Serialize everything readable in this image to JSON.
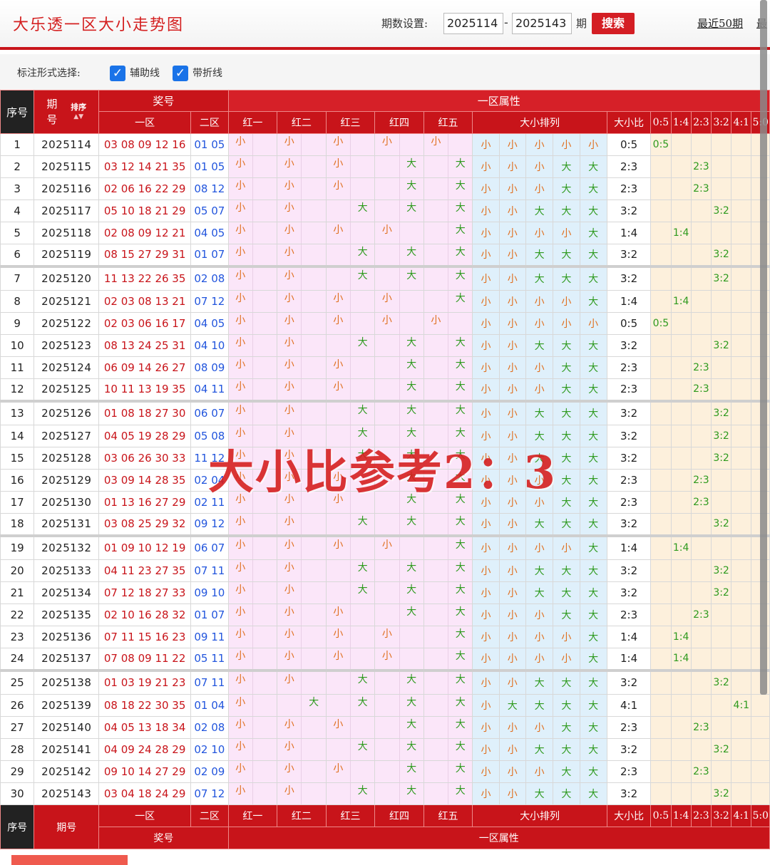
{
  "page": {
    "title": "大乐透一区大小走势图"
  },
  "period": {
    "label": "期数设置:",
    "from": "2025114",
    "dash": "-",
    "to": "2025143",
    "qi": "期",
    "search": "搜索",
    "recent": "最近50期",
    "recent_more": "最"
  },
  "options": {
    "label": "标注形式选择:",
    "aux_label": "辅助线",
    "line_label": "带折线"
  },
  "header": {
    "seq": "序号",
    "issue": "期号",
    "issue_top": "期",
    "issue_bottom": "号",
    "sort": "排序",
    "prize": "奖号",
    "zone_attr": "一区属性",
    "front": "一区",
    "back": "二区",
    "reds": [
      "红一",
      "红二",
      "红三",
      "红四",
      "红五"
    ],
    "arrangement": "大小排列",
    "ratio": "大小比",
    "dist": [
      "0:5",
      "1:4",
      "2:3",
      "3:2",
      "4:1",
      "5:0"
    ]
  },
  "rows": [
    {
      "seq": "1",
      "issue": "2025114",
      "front": "03 08 09 12 16",
      "back": "01 05",
      "reds": [
        "小",
        "小",
        "小",
        "小",
        "小"
      ],
      "arr": [
        "小",
        "小",
        "小",
        "小",
        "小"
      ],
      "ratio": "0:5"
    },
    {
      "seq": "2",
      "issue": "2025115",
      "front": "03 12 14 21 35",
      "back": "01 05",
      "reds": [
        "小",
        "小",
        "小",
        "大",
        "大"
      ],
      "arr": [
        "小",
        "小",
        "小",
        "大",
        "大"
      ],
      "ratio": "2:3"
    },
    {
      "seq": "3",
      "issue": "2025116",
      "front": "02 06 16 22 29",
      "back": "08 12",
      "reds": [
        "小",
        "小",
        "小",
        "大",
        "大"
      ],
      "arr": [
        "小",
        "小",
        "小",
        "大",
        "大"
      ],
      "ratio": "2:3"
    },
    {
      "seq": "4",
      "issue": "2025117",
      "front": "05 10 18 21 29",
      "back": "05 07",
      "reds": [
        "小",
        "小",
        "大",
        "大",
        "大"
      ],
      "arr": [
        "小",
        "小",
        "大",
        "大",
        "大"
      ],
      "ratio": "3:2"
    },
    {
      "seq": "5",
      "issue": "2025118",
      "front": "02 08 09 12 21",
      "back": "04 05",
      "reds": [
        "小",
        "小",
        "小",
        "小",
        "大"
      ],
      "arr": [
        "小",
        "小",
        "小",
        "小",
        "大"
      ],
      "ratio": "1:4"
    },
    {
      "seq": "6",
      "issue": "2025119",
      "front": "08 15 27 29 31",
      "back": "01 07",
      "reds": [
        "小",
        "小",
        "大",
        "大",
        "大"
      ],
      "arr": [
        "小",
        "小",
        "大",
        "大",
        "大"
      ],
      "ratio": "3:2"
    },
    {
      "seq": "7",
      "issue": "2025120",
      "front": "11 13 22 26 35",
      "back": "02 08",
      "reds": [
        "小",
        "小",
        "大",
        "大",
        "大"
      ],
      "arr": [
        "小",
        "小",
        "大",
        "大",
        "大"
      ],
      "ratio": "3:2"
    },
    {
      "seq": "8",
      "issue": "2025121",
      "front": "02 03 08 13 21",
      "back": "07 12",
      "reds": [
        "小",
        "小",
        "小",
        "小",
        "大"
      ],
      "arr": [
        "小",
        "小",
        "小",
        "小",
        "大"
      ],
      "ratio": "1:4"
    },
    {
      "seq": "9",
      "issue": "2025122",
      "front": "02 03 06 16 17",
      "back": "04 05",
      "reds": [
        "小",
        "小",
        "小",
        "小",
        "小"
      ],
      "arr": [
        "小",
        "小",
        "小",
        "小",
        "小"
      ],
      "ratio": "0:5"
    },
    {
      "seq": "10",
      "issue": "2025123",
      "front": "08 13 24 25 31",
      "back": "04 10",
      "reds": [
        "小",
        "小",
        "大",
        "大",
        "大"
      ],
      "arr": [
        "小",
        "小",
        "大",
        "大",
        "大"
      ],
      "ratio": "3:2"
    },
    {
      "seq": "11",
      "issue": "2025124",
      "front": "06 09 14 26 27",
      "back": "08 09",
      "reds": [
        "小",
        "小",
        "小",
        "大",
        "大"
      ],
      "arr": [
        "小",
        "小",
        "小",
        "大",
        "大"
      ],
      "ratio": "2:3"
    },
    {
      "seq": "12",
      "issue": "2025125",
      "front": "10 11 13 19 35",
      "back": "04 11",
      "reds": [
        "小",
        "小",
        "小",
        "大",
        "大"
      ],
      "arr": [
        "小",
        "小",
        "小",
        "大",
        "大"
      ],
      "ratio": "2:3"
    },
    {
      "seq": "13",
      "issue": "2025126",
      "front": "01 08 18 27 30",
      "back": "06 07",
      "reds": [
        "小",
        "小",
        "大",
        "大",
        "大"
      ],
      "arr": [
        "小",
        "小",
        "大",
        "大",
        "大"
      ],
      "ratio": "3:2"
    },
    {
      "seq": "14",
      "issue": "2025127",
      "front": "04 05 19 28 29",
      "back": "05 08",
      "reds": [
        "小",
        "小",
        "大",
        "大",
        "大"
      ],
      "arr": [
        "小",
        "小",
        "大",
        "大",
        "大"
      ],
      "ratio": "3:2"
    },
    {
      "seq": "15",
      "issue": "2025128",
      "front": "03 06 26 30 33",
      "back": "11 12",
      "reds": [
        "小",
        "小",
        "大",
        "大",
        "大"
      ],
      "arr": [
        "小",
        "小",
        "大",
        "大",
        "大"
      ],
      "ratio": "3:2"
    },
    {
      "seq": "16",
      "issue": "2025129",
      "front": "03 09 14 28 35",
      "back": "02 04",
      "reds": [
        "小",
        "小",
        "小",
        "大",
        "大"
      ],
      "arr": [
        "小",
        "小",
        "小",
        "大",
        "大"
      ],
      "ratio": "2:3"
    },
    {
      "seq": "17",
      "issue": "2025130",
      "front": "01 13 16 27 29",
      "back": "02 11",
      "reds": [
        "小",
        "小",
        "小",
        "大",
        "大"
      ],
      "arr": [
        "小",
        "小",
        "小",
        "大",
        "大"
      ],
      "ratio": "2:3"
    },
    {
      "seq": "18",
      "issue": "2025131",
      "front": "03 08 25 29 32",
      "back": "09 12",
      "reds": [
        "小",
        "小",
        "大",
        "大",
        "大"
      ],
      "arr": [
        "小",
        "小",
        "大",
        "大",
        "大"
      ],
      "ratio": "3:2"
    },
    {
      "seq": "19",
      "issue": "2025132",
      "front": "01 09 10 12 19",
      "back": "06 07",
      "reds": [
        "小",
        "小",
        "小",
        "小",
        "大"
      ],
      "arr": [
        "小",
        "小",
        "小",
        "小",
        "大"
      ],
      "ratio": "1:4"
    },
    {
      "seq": "20",
      "issue": "2025133",
      "front": "04 11 23 27 35",
      "back": "07 11",
      "reds": [
        "小",
        "小",
        "大",
        "大",
        "大"
      ],
      "arr": [
        "小",
        "小",
        "大",
        "大",
        "大"
      ],
      "ratio": "3:2"
    },
    {
      "seq": "21",
      "issue": "2025134",
      "front": "07 12 18 27 33",
      "back": "09 10",
      "reds": [
        "小",
        "小",
        "大",
        "大",
        "大"
      ],
      "arr": [
        "小",
        "小",
        "大",
        "大",
        "大"
      ],
      "ratio": "3:2"
    },
    {
      "seq": "22",
      "issue": "2025135",
      "front": "02 10 16 28 32",
      "back": "01 07",
      "reds": [
        "小",
        "小",
        "小",
        "大",
        "大"
      ],
      "arr": [
        "小",
        "小",
        "小",
        "大",
        "大"
      ],
      "ratio": "2:3"
    },
    {
      "seq": "23",
      "issue": "2025136",
      "front": "07 11 15 16 23",
      "back": "09 11",
      "reds": [
        "小",
        "小",
        "小",
        "小",
        "大"
      ],
      "arr": [
        "小",
        "小",
        "小",
        "小",
        "大"
      ],
      "ratio": "1:4"
    },
    {
      "seq": "24",
      "issue": "2025137",
      "front": "07 08 09 11 22",
      "back": "05 11",
      "reds": [
        "小",
        "小",
        "小",
        "小",
        "大"
      ],
      "arr": [
        "小",
        "小",
        "小",
        "小",
        "大"
      ],
      "ratio": "1:4"
    },
    {
      "seq": "25",
      "issue": "2025138",
      "front": "01 03 19 21 23",
      "back": "07 11",
      "reds": [
        "小",
        "小",
        "大",
        "大",
        "大"
      ],
      "arr": [
        "小",
        "小",
        "大",
        "大",
        "大"
      ],
      "ratio": "3:2"
    },
    {
      "seq": "26",
      "issue": "2025139",
      "front": "08 18 22 30 35",
      "back": "01 04",
      "reds": [
        "小",
        "大",
        "大",
        "大",
        "大"
      ],
      "arr": [
        "小",
        "大",
        "大",
        "大",
        "大"
      ],
      "ratio": "4:1"
    },
    {
      "seq": "27",
      "issue": "2025140",
      "front": "04 05 13 18 34",
      "back": "02 08",
      "reds": [
        "小",
        "小",
        "小",
        "大",
        "大"
      ],
      "arr": [
        "小",
        "小",
        "小",
        "大",
        "大"
      ],
      "ratio": "2:3"
    },
    {
      "seq": "28",
      "issue": "2025141",
      "front": "04 09 24 28 29",
      "back": "02 10",
      "reds": [
        "小",
        "小",
        "大",
        "大",
        "大"
      ],
      "arr": [
        "小",
        "小",
        "大",
        "大",
        "大"
      ],
      "ratio": "3:2"
    },
    {
      "seq": "29",
      "issue": "2025142",
      "front": "09 10 14 27 29",
      "back": "02 09",
      "reds": [
        "小",
        "小",
        "小",
        "大",
        "大"
      ],
      "arr": [
        "小",
        "小",
        "小",
        "大",
        "大"
      ],
      "ratio": "2:3"
    },
    {
      "seq": "30",
      "issue": "2025143",
      "front": "03 04 18 24 29",
      "back": "07 12",
      "reds": [
        "小",
        "小",
        "大",
        "大",
        "大"
      ],
      "arr": [
        "小",
        "小",
        "大",
        "大",
        "大"
      ],
      "ratio": "3:2"
    }
  ],
  "overlay": {
    "text": "大小比参考2：3"
  },
  "colors": {
    "brand_red": "#c8141a",
    "small": "#e07020",
    "big": "#2e9a1e",
    "pink": "#fbe6f9",
    "blue": "#dff0fb",
    "peach": "#fdf0dc"
  }
}
